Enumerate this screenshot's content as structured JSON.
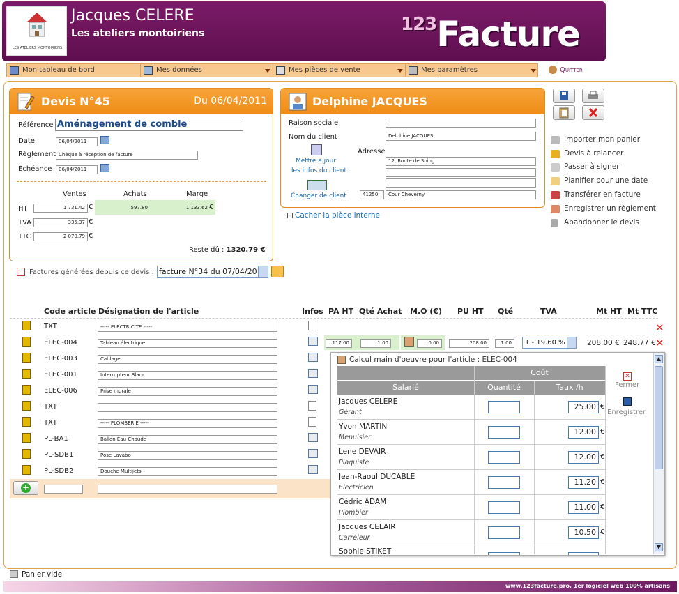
{
  "header": {
    "user_name": "Jacques CELERE",
    "company": "Les ateliers montoiriens",
    "logo_caption": "LES ATELIERS MONTOIRIENS",
    "brand_num": "123",
    "brand": "Facture"
  },
  "menu": {
    "dashboard": "Mon tableau de bord",
    "data": "Mes données",
    "sales": "Mes pièces de vente",
    "settings": "Mes paramètres",
    "quit": "Quitter"
  },
  "devis": {
    "title": "Devis N°45",
    "date_title": "Du 06/04/2011",
    "reference_label": "Référence",
    "reference_value": "Aménagement de comble",
    "date_label": "Date",
    "date_value": "06/04/2011",
    "reglement_label": "Règlement",
    "reglement_value": "Chèque à réception de facture",
    "echeance_label": "Échéance",
    "echeance_value": "06/04/2011",
    "col_ventes": "Ventes",
    "col_achats": "Achats",
    "col_marge": "Marge",
    "ht_label": "HT",
    "ht_ventes": "1 731.42",
    "ht_achats": "597.80",
    "ht_marge": "1 133.62",
    "tva_label": "TVA",
    "tva_value": "335.37",
    "ttc_label": "TTC",
    "ttc_value": "2 070.79",
    "euro": "€",
    "reste_label": "Reste dû :",
    "reste_value": "1320.79 €"
  },
  "factures": {
    "label": "Factures générées depuis ce devis :",
    "selected": "facture N°34 du 07/04/2011"
  },
  "client": {
    "name": "Delphine JACQUES",
    "raison_label": "Raison sociale",
    "nom_label": "Nom du client",
    "nom_value": "Delphine JACQUES",
    "adresse_label": "Adresse",
    "addr1": "12, Route de Soing",
    "addr2": "",
    "addr3": "",
    "cp": "41250",
    "ville": "Cour Cheverny",
    "update_link_1": "Mettre à jour",
    "update_link_2": "les infos du client",
    "change_link": "Changer de client",
    "hide_link": "Cacher la pièce interne"
  },
  "actions": [
    "Importer mon panier",
    "Devis à relancer",
    "Passer à signer",
    "Planifier pour une date",
    "Transférer en facture",
    "Enregistrer un règlement",
    "Abandonner le devis"
  ],
  "table": {
    "headers": {
      "code": "Code article",
      "designation": "Désignation de l'article",
      "infos": "Infos",
      "pa_ht": "PA HT",
      "qte_achat": "Qté Achat",
      "mo": "M.O (€)",
      "pu_ht": "PU HT",
      "qte": "Qté",
      "tva": "TVA",
      "mt_ht": "Mt HT",
      "mt_ttc": "Mt TTC"
    },
    "rows": [
      {
        "code": "TXT",
        "designation": "----- ELECTRICITE -----"
      },
      {
        "code": "ELEC-004",
        "designation": "Tableau électrique",
        "pa": "117.00",
        "qa": "1.00",
        "mo": "0.00",
        "pu": "208.00",
        "q": "1.00",
        "tva": "1 - 19.60 %",
        "mt_ht": "208.00 €",
        "mt_ttc": "248.77 €"
      },
      {
        "code": "ELEC-003",
        "designation": "Cablage"
      },
      {
        "code": "ELEC-001",
        "designation": "Interrupteur Blanc"
      },
      {
        "code": "ELEC-006",
        "designation": "Prise murale"
      },
      {
        "code": "TXT",
        "designation": ""
      },
      {
        "code": "TXT",
        "designation": "----- PLOMBERIE -----"
      },
      {
        "code": "PL-BA1",
        "designation": "Ballon Eau Chaude"
      },
      {
        "code": "PL-SDB1",
        "designation": "Pose Lavabo"
      },
      {
        "code": "PL-SDB2",
        "designation": "Douche Multijets"
      }
    ]
  },
  "popup": {
    "title": "Calcul main d'oeuvre pour l'article : ELEC-004",
    "cout": "Coût",
    "salarie": "Salarié",
    "quantite": "Quantité",
    "taux": "Taux /h",
    "close": "Fermer",
    "save": "Enregistrer",
    "workers": [
      {
        "name": "Jacques CELERE",
        "role": "Gérant",
        "rate": "25.00"
      },
      {
        "name": "Yvon MARTIN",
        "role": "Menuisier",
        "rate": "12.00"
      },
      {
        "name": "Lene DEVAIR",
        "role": "Plaquiste",
        "rate": "12.00"
      },
      {
        "name": "Jean-Raoul DUCABLE",
        "role": "Electricien",
        "rate": "11.20"
      },
      {
        "name": "Cédric ADAM",
        "role": "Plombier",
        "rate": "11.00"
      },
      {
        "name": "Jacques CELAIR",
        "role": "Carreleur",
        "rate": "10.50"
      },
      {
        "name": "Sophie STIKET",
        "role": "",
        "rate": ""
      }
    ]
  },
  "footer": {
    "cart": "Panier vide",
    "site": "www.123facture.pro, 1er logiciel web 100% artisans"
  }
}
